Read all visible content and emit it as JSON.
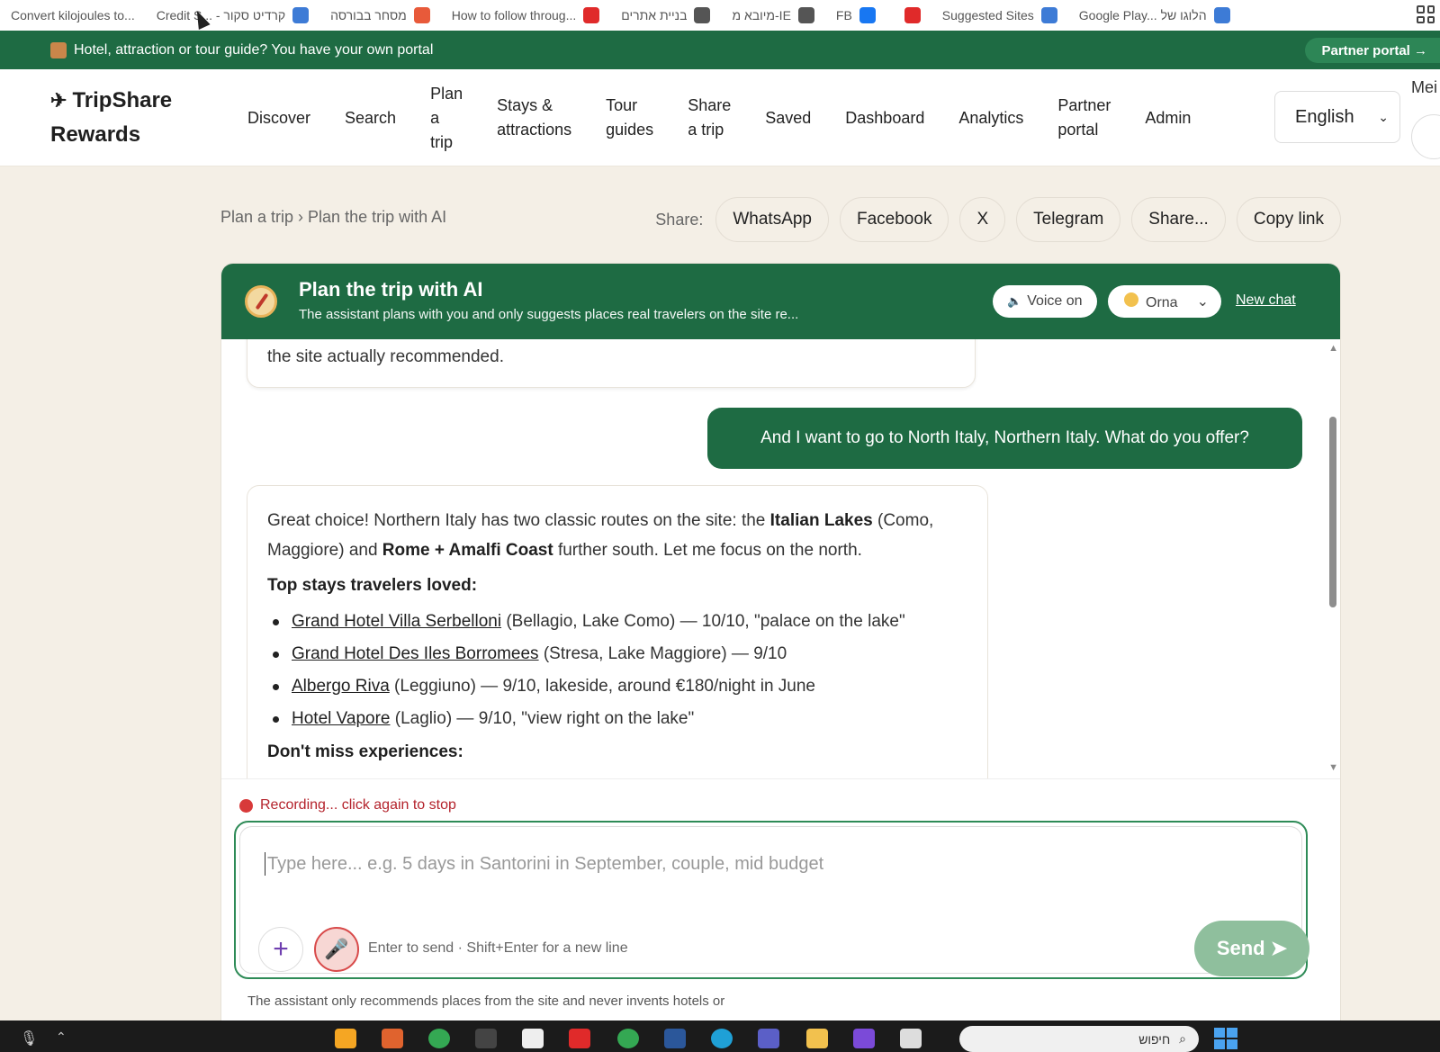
{
  "bookmarks": [
    {
      "label": "Convert kilojoules to...",
      "icon": "none",
      "color": "#999999"
    },
    {
      "label": "Credit S... - קרדיט סקור",
      "icon": "scale-icon",
      "color": "#3d7bd6"
    },
    {
      "label": "מסחר בבורסה",
      "icon": "bird-icon",
      "color": "#e85a3a"
    },
    {
      "label": "How to follow throug...",
      "icon": "youtube-icon",
      "color": "#e02a2a"
    },
    {
      "label": "בניית אתרים",
      "icon": "page-icon",
      "color": "#555555"
    },
    {
      "label": "מיובא מ-IE",
      "icon": "folder-icon",
      "color": "#555555"
    },
    {
      "label": "FB",
      "icon": "facebook-icon",
      "color": "#1877f2"
    },
    {
      "label": "",
      "icon": "youtube-icon",
      "color": "#e02a2a"
    },
    {
      "label": "Suggested Sites",
      "icon": "search-icon",
      "color": "#3d7bd6"
    },
    {
      "label": "Google Play... הלוגו של",
      "icon": "pen-icon",
      "color": "#3d7bd6"
    }
  ],
  "banner": {
    "text": "Hotel, attraction or tour guide? You have your own portal",
    "button": "Partner portal →"
  },
  "header": {
    "logo_line1": "TripShare",
    "logo_line2": "Rewards",
    "nav": [
      {
        "label": "Discover",
        "lines": [
          "Discover"
        ]
      },
      {
        "label": "Search",
        "lines": [
          "Search"
        ]
      },
      {
        "label": "Plan a trip",
        "lines": [
          "Plan",
          "a",
          "trip"
        ]
      },
      {
        "label": "Stays & attractions",
        "lines": [
          "Stays &",
          "attractions"
        ]
      },
      {
        "label": "Tour guides",
        "lines": [
          "Tour",
          "guides"
        ]
      },
      {
        "label": "Share a trip",
        "lines": [
          "Share",
          "a trip"
        ]
      },
      {
        "label": "Saved",
        "lines": [
          "Saved"
        ]
      },
      {
        "label": "Dashboard",
        "lines": [
          "Dashboard"
        ]
      },
      {
        "label": "Analytics",
        "lines": [
          "Analytics"
        ]
      },
      {
        "label": "Partner portal",
        "lines": [
          "Partner",
          "portal"
        ]
      },
      {
        "label": "Admin",
        "lines": [
          "Admin"
        ]
      }
    ],
    "language": "English",
    "me_label": "Mei"
  },
  "breadcrumb": "Plan a trip › Plan the trip with AI",
  "share": {
    "label": "Share:",
    "buttons": [
      "WhatsApp",
      "Facebook",
      "X",
      "Telegram",
      "Share...",
      "Copy link"
    ]
  },
  "chat": {
    "title": "Plan the trip with AI",
    "subtitle": "The assistant plans with you and only suggests places real travelers on the site re...",
    "voice": "Voice on",
    "persona": "Orna",
    "new_chat": "New chat",
    "prev_bot_tail": "the site actually recommended.",
    "user_message": "And I want to go to North Italy, Northern Italy. What do you offer?",
    "bot": {
      "intro_1": "Great choice! Northern Italy has two classic routes on the site: the ",
      "intro_bold_1": "Italian Lakes",
      "intro_2": " (Como, Maggiore) and ",
      "intro_bold_2": "Rome + Amalfi Coast",
      "intro_3": " further south. Let me focus on the north.",
      "heading": "Top stays travelers loved:",
      "stays": [
        {
          "name": "Grand Hotel Villa Serbelloni",
          "detail": " (Bellagio, Lake Como) — 10/10, \"palace on the lake\""
        },
        {
          "name": "Grand Hotel Des Iles Borromees",
          "detail": " (Stresa, Lake Maggiore) — 9/10"
        },
        {
          "name": "Albergo Riva",
          "detail": " (Leggiuno) — 9/10, lakeside, around €180/night in June"
        },
        {
          "name": "Hotel Vapore",
          "detail": " (Laglio) — 9/10, \"view right on the lake\""
        }
      ],
      "next_heading": "Don't miss experiences:"
    },
    "recording": "Recording... click again to stop",
    "input_placeholder": "Type here... e.g. 5 days in Santorini in September, couple, mid budget",
    "hint": "Enter to send · Shift+Enter for a new line",
    "send": "Send ➤",
    "footnote": "The assistant only recommends places from the site and never invents hotels or"
  },
  "taskbar": {
    "search_text": "חיפוש"
  },
  "colors": {
    "brand_green": "#1e6b43",
    "send_disabled": "#8fbf9d",
    "recording_red": "#d83a3a",
    "page_bg": "#f4efe6"
  }
}
